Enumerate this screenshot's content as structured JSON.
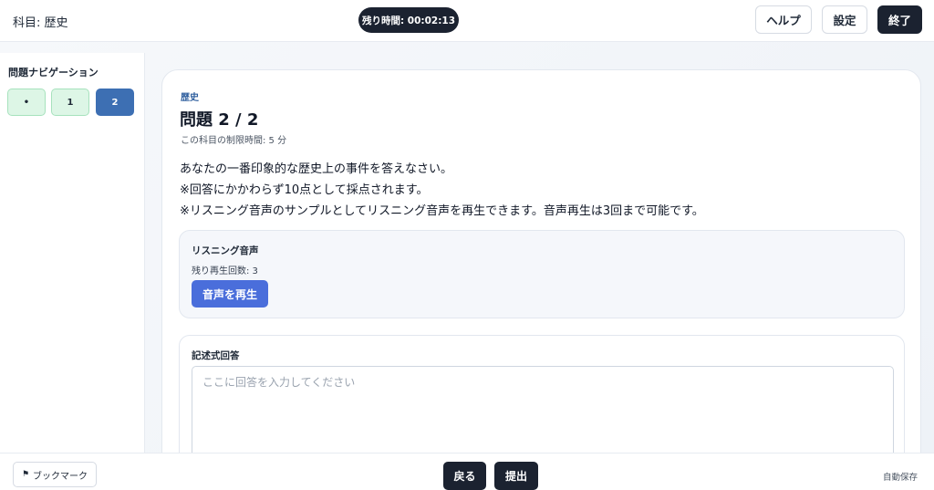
{
  "header": {
    "subject_label": "科目: 歴史",
    "timer": "残り時間: 00:02:13",
    "help_label": "ヘルプ",
    "settings_label": "設定",
    "exit_label": "終了"
  },
  "sidebar": {
    "title": "問題ナビゲーション",
    "questions": [
      {
        "label": "•",
        "state": "answered"
      },
      {
        "label": "1",
        "state": "answered"
      },
      {
        "label": "2",
        "state": "current"
      }
    ]
  },
  "main": {
    "subject": "歴史",
    "question_title": "問題 2 / 2",
    "time_limit": "この科目の制限時間: 5 分",
    "question_lines": [
      "あなたの一番印象的な歴史上の事件を答えなさい。",
      "※回答にかかわらず10点として採点されます。",
      "※リスニング音声のサンプルとしてリスニング音声を再生できます。音声再生は3回まで可能です。"
    ],
    "listening": {
      "title": "リスニング音声",
      "remaining": "残り再生回数: 3",
      "play_label": "音声を再生"
    },
    "answer": {
      "title": "記述式回答",
      "placeholder": "ここに回答を入力してください",
      "value": ""
    }
  },
  "footer": {
    "bookmark_label": "ブックマーク",
    "bookmark_icon": "flag-icon",
    "back_label": "戻る",
    "submit_label": "提出",
    "autosave_label": "自動保存"
  }
}
